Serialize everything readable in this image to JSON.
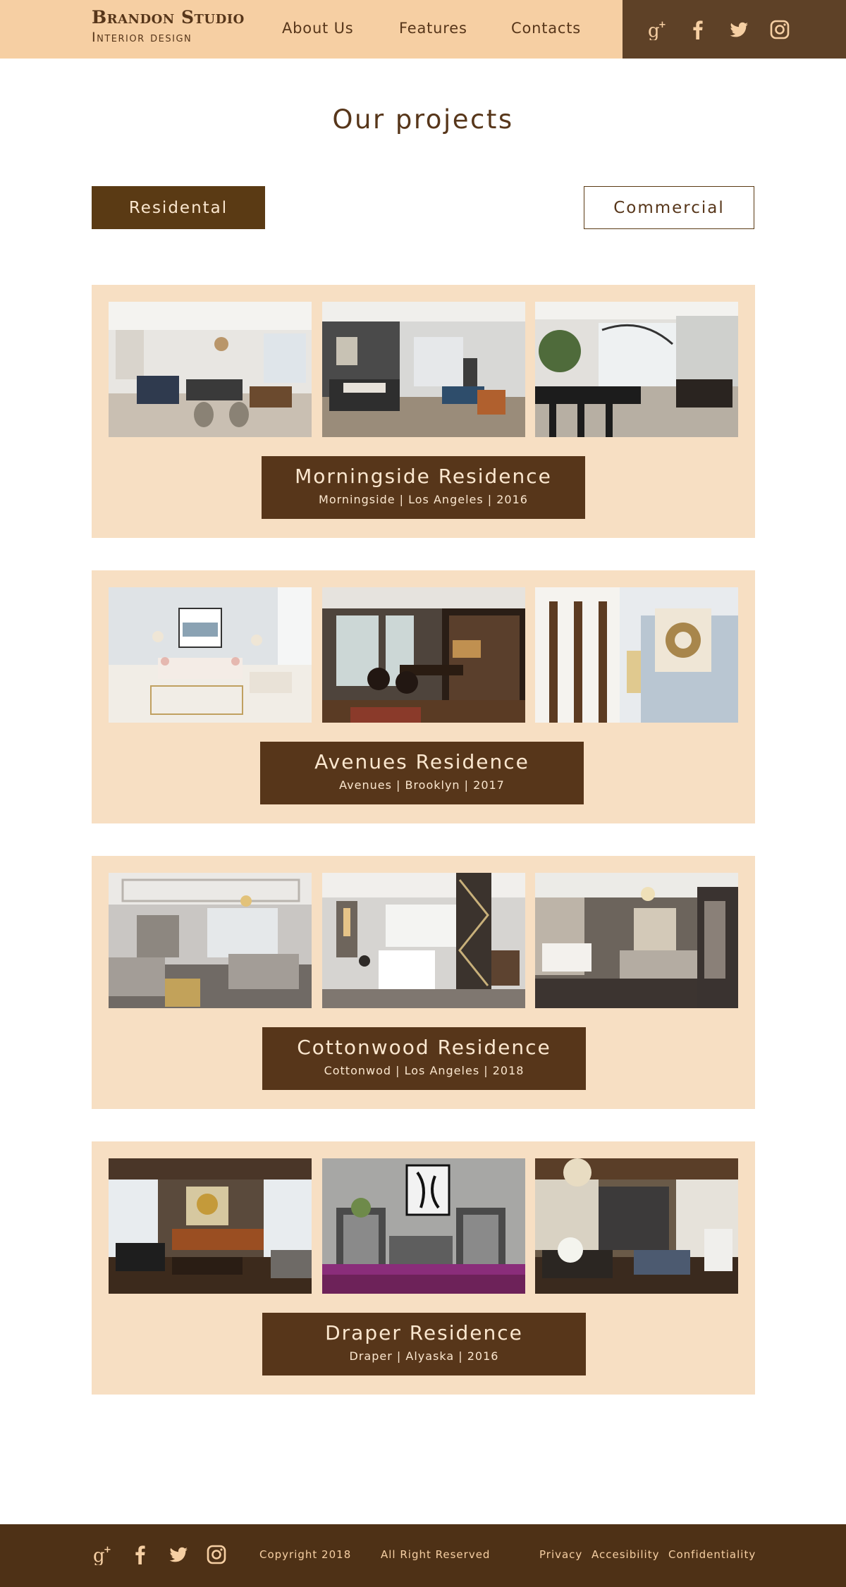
{
  "brand": {
    "name": "Brandon Studio",
    "tagline": "Interior design"
  },
  "nav": {
    "items": [
      {
        "label": "About Us"
      },
      {
        "label": "Features"
      },
      {
        "label": "Contacts"
      }
    ]
  },
  "social": {
    "icons": [
      "google-plus-icon",
      "facebook-icon",
      "twitter-icon",
      "instagram-icon"
    ]
  },
  "page": {
    "title": "Our projects"
  },
  "filters": {
    "residential_label": "Residental",
    "commercial_label": "Commercial",
    "active": "residential"
  },
  "projects": [
    {
      "title": "Morningside Residence",
      "subtitle": "Morningside | Los Angeles | 2016"
    },
    {
      "title": "Avenues Residence",
      "subtitle": "Avenues | Brooklyn | 2017"
    },
    {
      "title": "Cottonwood Residence",
      "subtitle": "Cottonwod | Los Angeles | 2018"
    },
    {
      "title": "Draper Residence",
      "subtitle": "Draper | Alyaska | 2016"
    }
  ],
  "footer": {
    "copyright": "Copyright 2018",
    "rights": "All Right Reserved",
    "links": [
      {
        "label": "Privacy"
      },
      {
        "label": "Accesibility"
      },
      {
        "label": "Confidentiality"
      }
    ]
  },
  "colors": {
    "header_bg": "#f6cfa3",
    "accent_dark": "#57361a",
    "card_bg": "#f7dfc3",
    "footer_bg": "#4e3116",
    "social_box_bg": "#5e4127"
  }
}
